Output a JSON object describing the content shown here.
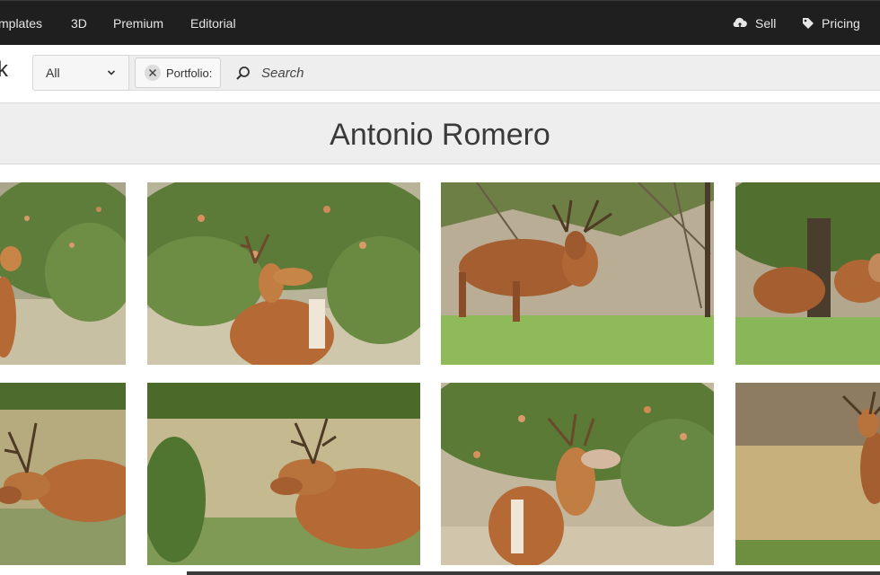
{
  "nav": {
    "items": [
      "mplates",
      "3D",
      "Premium",
      "Editorial"
    ],
    "sell": "Sell",
    "pricing": "Pricing"
  },
  "search": {
    "logo_fragment": "k",
    "filter_selected": "All",
    "chip_label": "Portfolio:",
    "placeholder": "Search"
  },
  "page": {
    "title": "Antonio Romero"
  },
  "thumbnails": [
    {
      "row": 1,
      "col": 1,
      "subject": "deer"
    },
    {
      "row": 1,
      "col": 2,
      "subject": "deer"
    },
    {
      "row": 1,
      "col": 3,
      "subject": "deer"
    },
    {
      "row": 1,
      "col": 4,
      "subject": "deer"
    },
    {
      "row": 2,
      "col": 1,
      "subject": "deer"
    },
    {
      "row": 2,
      "col": 2,
      "subject": "deer"
    },
    {
      "row": 2,
      "col": 3,
      "subject": "deer"
    },
    {
      "row": 2,
      "col": 4,
      "subject": "deer"
    }
  ],
  "colors": {
    "nav_bg": "#1f1f1f",
    "deer_fur": "#b56a35",
    "grass": "#7fa84e",
    "foliage": "#5f7d3a"
  }
}
